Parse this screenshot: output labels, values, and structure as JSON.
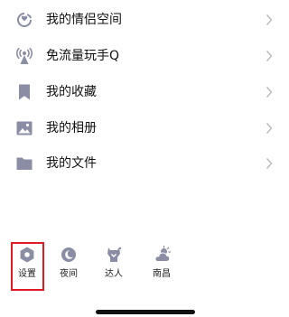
{
  "menu": {
    "items": [
      {
        "label": "我的情侣空间",
        "icon": "couple-space-icon"
      },
      {
        "label": "免流量玩手Q",
        "icon": "signal-tower-icon"
      },
      {
        "label": "我的收藏",
        "icon": "bookmark-icon"
      },
      {
        "label": "我的相册",
        "icon": "photo-album-icon"
      },
      {
        "label": "我的文件",
        "icon": "folder-icon"
      }
    ]
  },
  "bottom": {
    "settings": {
      "label": "设置",
      "icon": "settings-hexagon-icon"
    },
    "night": {
      "label": "夜间",
      "icon": "moon-icon"
    },
    "expert": {
      "label": "达人",
      "icon": "expert-icon"
    },
    "weather": {
      "label": "南昌",
      "icon": "weather-cloud-icon"
    }
  },
  "colors": {
    "icon": "#8a8da3",
    "text": "#111111",
    "chevron": "#b8b8c0",
    "highlight": "#e01a22"
  }
}
